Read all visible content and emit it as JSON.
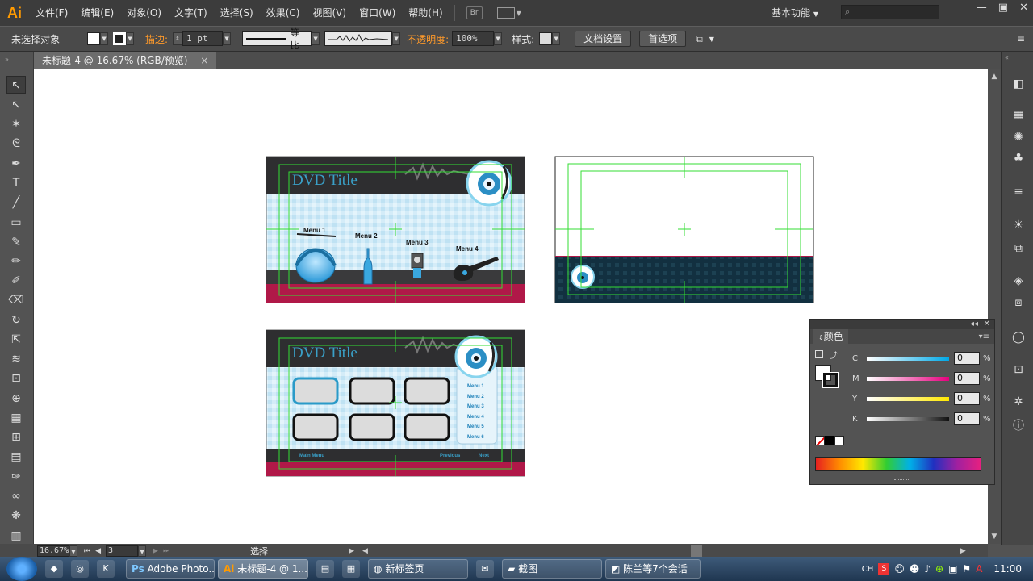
{
  "app": {
    "logo": "Ai",
    "workspace": "基本功能",
    "br_label": "Br"
  },
  "menu": [
    "文件(F)",
    "编辑(E)",
    "对象(O)",
    "文字(T)",
    "选择(S)",
    "效果(C)",
    "视图(V)",
    "窗口(W)",
    "帮助(H)"
  ],
  "window_controls": {
    "minimize": "—",
    "restore": "▣",
    "close": "✕"
  },
  "control": {
    "selection": "未选择对象",
    "stroke_label": "描边:",
    "stroke_value": "1 pt",
    "stroke_profile": "等比",
    "opacity_label": "不透明度:",
    "opacity_value": "100%",
    "style_label": "样式:",
    "doc_setup": "文档设置",
    "preferences": "首选项"
  },
  "document_tab": {
    "title": "未标题-4 @ 16.67% (RGB/预览)",
    "close": "×"
  },
  "status": {
    "zoom": "16.67%",
    "artboard": "3",
    "tool_name": "选择"
  },
  "artboard1": {
    "title": "DVD Title",
    "menus": [
      "Menu 1",
      "Menu 2",
      "Menu 3",
      "Menu 4"
    ]
  },
  "artboard3": {
    "title": "DVD Title",
    "menus": [
      "Menu 1",
      "Menu 2",
      "Menu 3",
      "Menu 4",
      "Menu 5",
      "Menu 6"
    ],
    "main_menu": "Main Menu",
    "previous": "Previous",
    "next": "Next"
  },
  "color_panel": {
    "title": "颜色",
    "channels": [
      {
        "label": "C",
        "value": "0",
        "unit": "%"
      },
      {
        "label": "M",
        "value": "0",
        "unit": "%"
      },
      {
        "label": "Y",
        "value": "0",
        "unit": "%"
      },
      {
        "label": "K",
        "value": "0",
        "unit": "%"
      }
    ]
  },
  "taskbar": {
    "items": [
      "Adobe Photo...",
      "未标题-4 @ 1...",
      "新标签页",
      "截图",
      "陈兰等7个会话"
    ],
    "lang": "CH",
    "clock": "11:00"
  },
  "colors": {
    "accent_orange": "#ff9a00",
    "guide_green": "#33dd33",
    "dvd_blue": "#3aa0c8",
    "footer_red": "#b01848",
    "dark_band": "#2e2e30",
    "tile_blue": "#cbe8f5"
  }
}
